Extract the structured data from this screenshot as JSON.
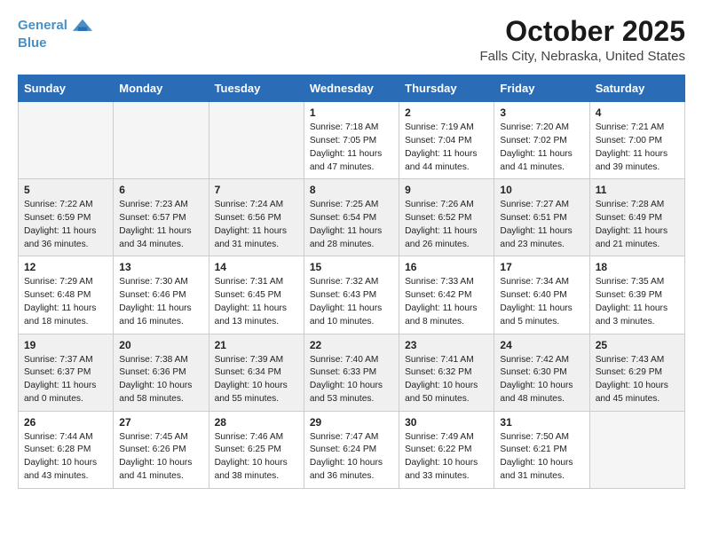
{
  "header": {
    "logo_line1": "General",
    "logo_line2": "Blue",
    "title": "October 2025",
    "subtitle": "Falls City, Nebraska, United States"
  },
  "days_of_week": [
    "Sunday",
    "Monday",
    "Tuesday",
    "Wednesday",
    "Thursday",
    "Friday",
    "Saturday"
  ],
  "rows": [
    {
      "cells": [
        {
          "day": "",
          "info": ""
        },
        {
          "day": "",
          "info": ""
        },
        {
          "day": "",
          "info": ""
        },
        {
          "day": "1",
          "info": "Sunrise: 7:18 AM\nSunset: 7:05 PM\nDaylight: 11 hours\nand 47 minutes."
        },
        {
          "day": "2",
          "info": "Sunrise: 7:19 AM\nSunset: 7:04 PM\nDaylight: 11 hours\nand 44 minutes."
        },
        {
          "day": "3",
          "info": "Sunrise: 7:20 AM\nSunset: 7:02 PM\nDaylight: 11 hours\nand 41 minutes."
        },
        {
          "day": "4",
          "info": "Sunrise: 7:21 AM\nSunset: 7:00 PM\nDaylight: 11 hours\nand 39 minutes."
        }
      ]
    },
    {
      "cells": [
        {
          "day": "5",
          "info": "Sunrise: 7:22 AM\nSunset: 6:59 PM\nDaylight: 11 hours\nand 36 minutes."
        },
        {
          "day": "6",
          "info": "Sunrise: 7:23 AM\nSunset: 6:57 PM\nDaylight: 11 hours\nand 34 minutes."
        },
        {
          "day": "7",
          "info": "Sunrise: 7:24 AM\nSunset: 6:56 PM\nDaylight: 11 hours\nand 31 minutes."
        },
        {
          "day": "8",
          "info": "Sunrise: 7:25 AM\nSunset: 6:54 PM\nDaylight: 11 hours\nand 28 minutes."
        },
        {
          "day": "9",
          "info": "Sunrise: 7:26 AM\nSunset: 6:52 PM\nDaylight: 11 hours\nand 26 minutes."
        },
        {
          "day": "10",
          "info": "Sunrise: 7:27 AM\nSunset: 6:51 PM\nDaylight: 11 hours\nand 23 minutes."
        },
        {
          "day": "11",
          "info": "Sunrise: 7:28 AM\nSunset: 6:49 PM\nDaylight: 11 hours\nand 21 minutes."
        }
      ]
    },
    {
      "cells": [
        {
          "day": "12",
          "info": "Sunrise: 7:29 AM\nSunset: 6:48 PM\nDaylight: 11 hours\nand 18 minutes."
        },
        {
          "day": "13",
          "info": "Sunrise: 7:30 AM\nSunset: 6:46 PM\nDaylight: 11 hours\nand 16 minutes."
        },
        {
          "day": "14",
          "info": "Sunrise: 7:31 AM\nSunset: 6:45 PM\nDaylight: 11 hours\nand 13 minutes."
        },
        {
          "day": "15",
          "info": "Sunrise: 7:32 AM\nSunset: 6:43 PM\nDaylight: 11 hours\nand 10 minutes."
        },
        {
          "day": "16",
          "info": "Sunrise: 7:33 AM\nSunset: 6:42 PM\nDaylight: 11 hours\nand 8 minutes."
        },
        {
          "day": "17",
          "info": "Sunrise: 7:34 AM\nSunset: 6:40 PM\nDaylight: 11 hours\nand 5 minutes."
        },
        {
          "day": "18",
          "info": "Sunrise: 7:35 AM\nSunset: 6:39 PM\nDaylight: 11 hours\nand 3 minutes."
        }
      ]
    },
    {
      "cells": [
        {
          "day": "19",
          "info": "Sunrise: 7:37 AM\nSunset: 6:37 PM\nDaylight: 11 hours\nand 0 minutes."
        },
        {
          "day": "20",
          "info": "Sunrise: 7:38 AM\nSunset: 6:36 PM\nDaylight: 10 hours\nand 58 minutes."
        },
        {
          "day": "21",
          "info": "Sunrise: 7:39 AM\nSunset: 6:34 PM\nDaylight: 10 hours\nand 55 minutes."
        },
        {
          "day": "22",
          "info": "Sunrise: 7:40 AM\nSunset: 6:33 PM\nDaylight: 10 hours\nand 53 minutes."
        },
        {
          "day": "23",
          "info": "Sunrise: 7:41 AM\nSunset: 6:32 PM\nDaylight: 10 hours\nand 50 minutes."
        },
        {
          "day": "24",
          "info": "Sunrise: 7:42 AM\nSunset: 6:30 PM\nDaylight: 10 hours\nand 48 minutes."
        },
        {
          "day": "25",
          "info": "Sunrise: 7:43 AM\nSunset: 6:29 PM\nDaylight: 10 hours\nand 45 minutes."
        }
      ]
    },
    {
      "cells": [
        {
          "day": "26",
          "info": "Sunrise: 7:44 AM\nSunset: 6:28 PM\nDaylight: 10 hours\nand 43 minutes."
        },
        {
          "day": "27",
          "info": "Sunrise: 7:45 AM\nSunset: 6:26 PM\nDaylight: 10 hours\nand 41 minutes."
        },
        {
          "day": "28",
          "info": "Sunrise: 7:46 AM\nSunset: 6:25 PM\nDaylight: 10 hours\nand 38 minutes."
        },
        {
          "day": "29",
          "info": "Sunrise: 7:47 AM\nSunset: 6:24 PM\nDaylight: 10 hours\nand 36 minutes."
        },
        {
          "day": "30",
          "info": "Sunrise: 7:49 AM\nSunset: 6:22 PM\nDaylight: 10 hours\nand 33 minutes."
        },
        {
          "day": "31",
          "info": "Sunrise: 7:50 AM\nSunset: 6:21 PM\nDaylight: 10 hours\nand 31 minutes."
        },
        {
          "day": "",
          "info": ""
        }
      ]
    }
  ]
}
